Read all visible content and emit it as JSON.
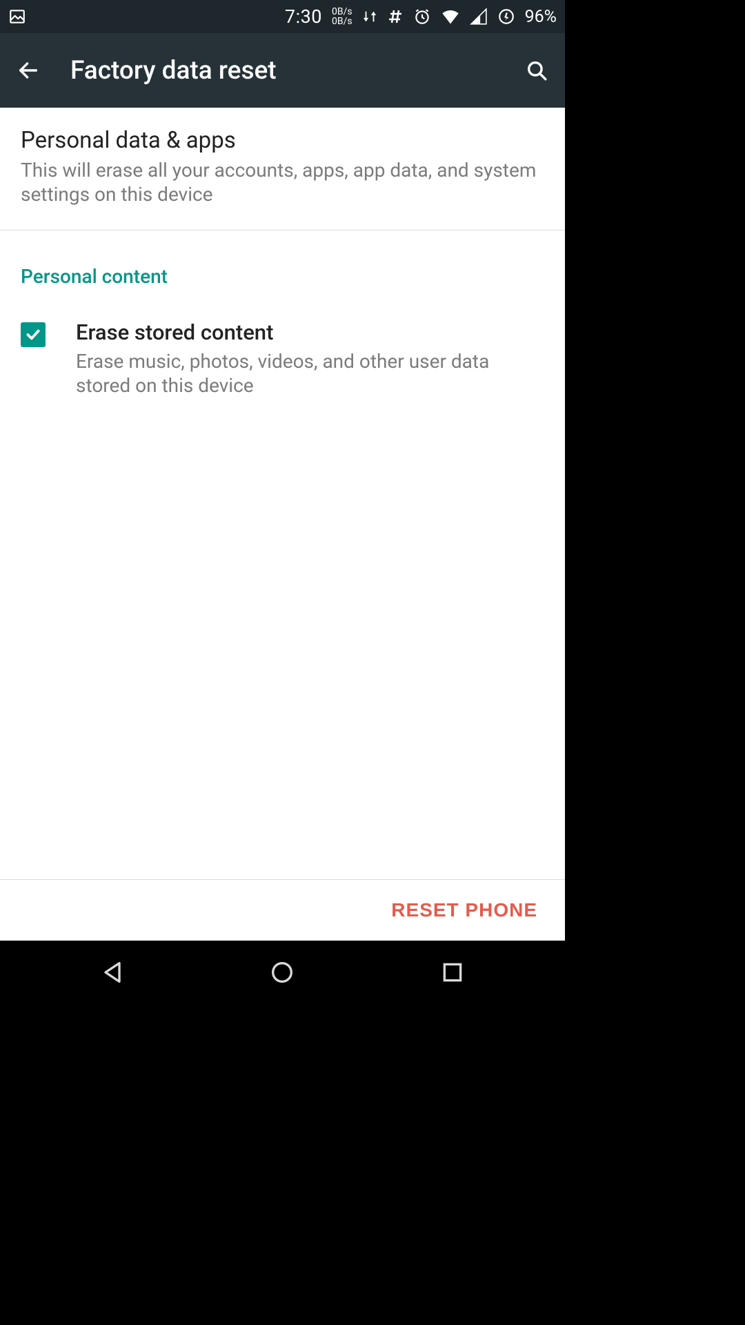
{
  "status": {
    "time": "7:30",
    "net_up": "0B/s",
    "net_down": "0B/s",
    "battery_pct": "96%"
  },
  "appbar": {
    "title": "Factory data reset"
  },
  "section_personal": {
    "title": "Personal data & apps",
    "desc": "This will erase all your accounts, apps, app data, and system settings on this device"
  },
  "section_content_header": "Personal content",
  "erase_pref": {
    "checked": true,
    "title": "Erase stored content",
    "desc": "Erase music, photos, videos, and other user data stored on this device"
  },
  "reset_button_label": "RESET PHONE"
}
